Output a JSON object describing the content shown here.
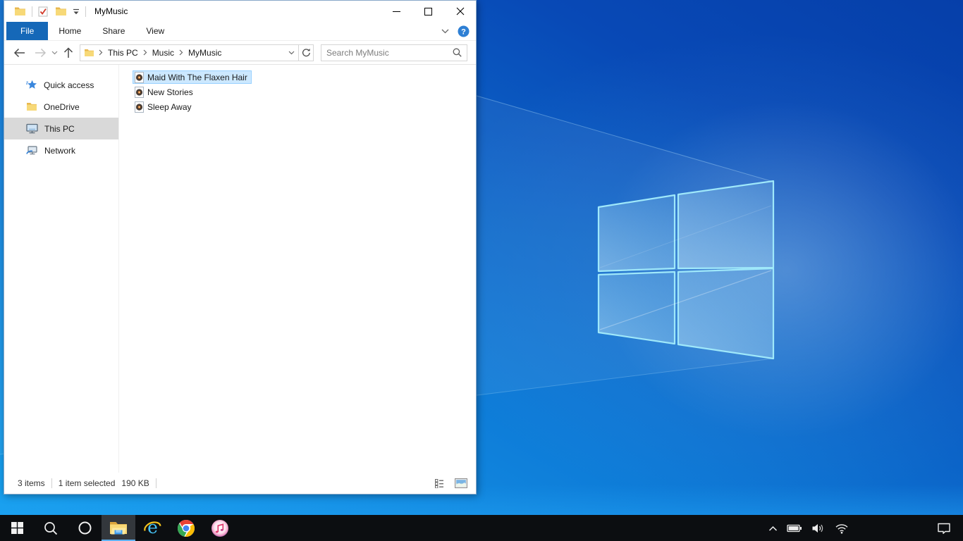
{
  "titlebar": {
    "title": "MyMusic"
  },
  "ribbon": {
    "tabs": [
      {
        "label": "File"
      },
      {
        "label": "Home"
      },
      {
        "label": "Share"
      },
      {
        "label": "View"
      }
    ]
  },
  "nav": {
    "breadcrumb": [
      "This PC",
      "Music",
      "MyMusic"
    ],
    "search_placeholder": "Search MyMusic"
  },
  "sidebar": {
    "items": [
      {
        "label": "Quick access"
      },
      {
        "label": "OneDrive"
      },
      {
        "label": "This PC"
      },
      {
        "label": "Network"
      }
    ]
  },
  "files": [
    {
      "name": "Maid With The Flaxen Hair"
    },
    {
      "name": "New Stories"
    },
    {
      "name": "Sleep Away"
    }
  ],
  "statusbar": {
    "items_count": "3 items",
    "selection_count": "1 item selected",
    "selection_size": "190 KB"
  },
  "colors": {
    "file_tab_blue": "#1568b8",
    "selection_bg": "#cce8ff",
    "selection_border": "#99d1ff",
    "sidebar_selected": "#d9d9d9",
    "taskbar": "#0c0e11",
    "taskbar_underline": "#5fb2f2",
    "wallpaper_dark": "#063fa9",
    "wallpaper_bright": "#17a3f0"
  }
}
